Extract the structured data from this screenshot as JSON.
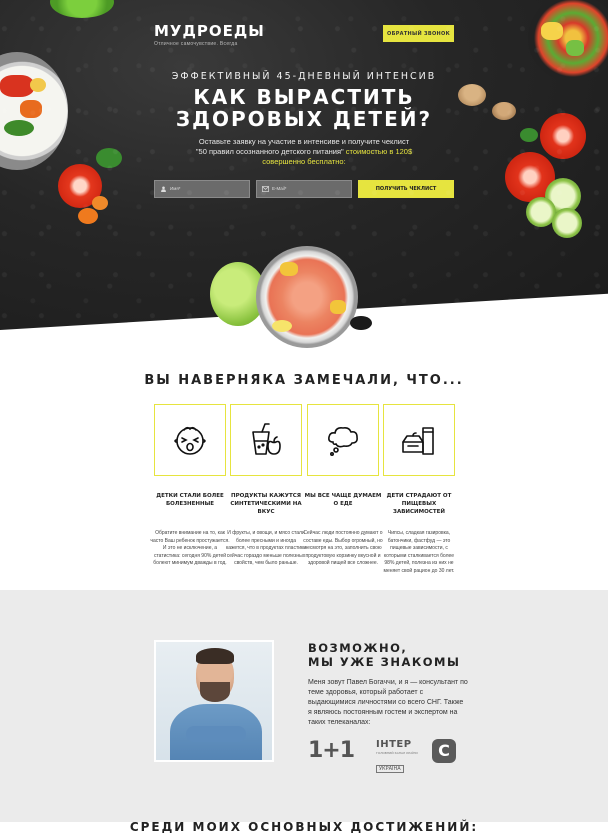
{
  "header": {
    "logo_name": "МУДРОЕДЫ",
    "logo_tagline": "Отличное самочувствие. Всегда",
    "callback_label": "ОБРАТНЫЙ ЗВОНОК"
  },
  "hero": {
    "kicker": "ЭФФЕКТИВНЫЙ 45-ДНЕВНЫЙ ИНТЕНСИВ",
    "title_line1": "КАК ВЫРАСТИТЬ",
    "title_line2": "ЗДОРОВЫХ ДЕТЕЙ?",
    "sub_line1": "Оставьте заявку на участие в интенсиве и получите чеклист",
    "sub_line2_plain": "\"50 правил осознанного детского питания\"",
    "sub_line2_highlight": " стоимостью в 120$",
    "sub_line3_highlight": "совершенно бесплатно:",
    "name_placeholder": "Имя*",
    "email_placeholder": "E-Mail*",
    "submit_label": "ПОЛУЧИТЬ ЧЕКЛИСТ"
  },
  "noticed": {
    "title": "ВЫ НАВЕРНЯКА ЗАМЕЧАЛИ, ЧТО...",
    "cards": [
      {
        "icon": "crying-child-icon",
        "title": "ДЕТКИ СТАЛИ БОЛЕЕ БОЛЕЗНЕННЫЕ",
        "text": "Обратите внимание на то, как часто Ваш ребенок простужается. И это не исключение, а статистика: сегодня 90% детей болеют минимум дважды в год."
      },
      {
        "icon": "juice-apple-icon",
        "title": "ПРОДУКТЫ КАЖУТСЯ СИНТЕТИЧЕСКИМИ НА ВКУС",
        "text": "И фрукты, и овощи, и мясо стали более пресными и иногда кажется, что в продуктах пластики сейчас гораздо меньше полезных свойств, чем было раньше."
      },
      {
        "icon": "thought-cloud-icon",
        "title": "МЫ ВСЕ ЧАЩЕ ДУМАЕМ О ЕДЕ",
        "text": "Сейчас люди постоянно думают о составе еды. Выбор огромный, но несмотря на это, заполнить свою продуктовую корзинку вкусной и здоровой пищей все сложнее."
      },
      {
        "icon": "fast-food-icon",
        "title": "ДЕТИ СТРАДАЮТ ОТ ПИЩЕВЫХ ЗАВИСИМОСТЕЙ",
        "text": "Чипсы, сладкая газировка, батончики, фастфуд — это пищевые зависимости, с которыми сталкивается более 98% детей, полезна из них не меняет свой рацион до 30 лет."
      }
    ]
  },
  "about": {
    "title_line1": "ВОЗМОЖНО,",
    "title_line2": "МЫ УЖЕ ЗНАКОМЫ",
    "text": "Меня зовут Павел Богаччи, и я — консультант по теме здоровья, который работает с выдающимися личностями со всего СНГ. Также я являюсь постоянным гостем и экспертом на таких телеканалах:",
    "tv": {
      "channel1": "1+1",
      "channel2": "ІНТЕР",
      "channel2_sub": "ГОЛОВНИЙ КАНАЛ КРАЇНИ",
      "channel2_country": "УКРАЇНА",
      "channel3": "С"
    }
  },
  "achievements": {
    "title": "СРЕДИ МОИХ ОСНОВНЫХ ДОСТИЖЕНИЙ:"
  },
  "colors": {
    "accent": "#e6e43f",
    "hero_bg": "#262626",
    "section_gray": "#ebebeb"
  }
}
